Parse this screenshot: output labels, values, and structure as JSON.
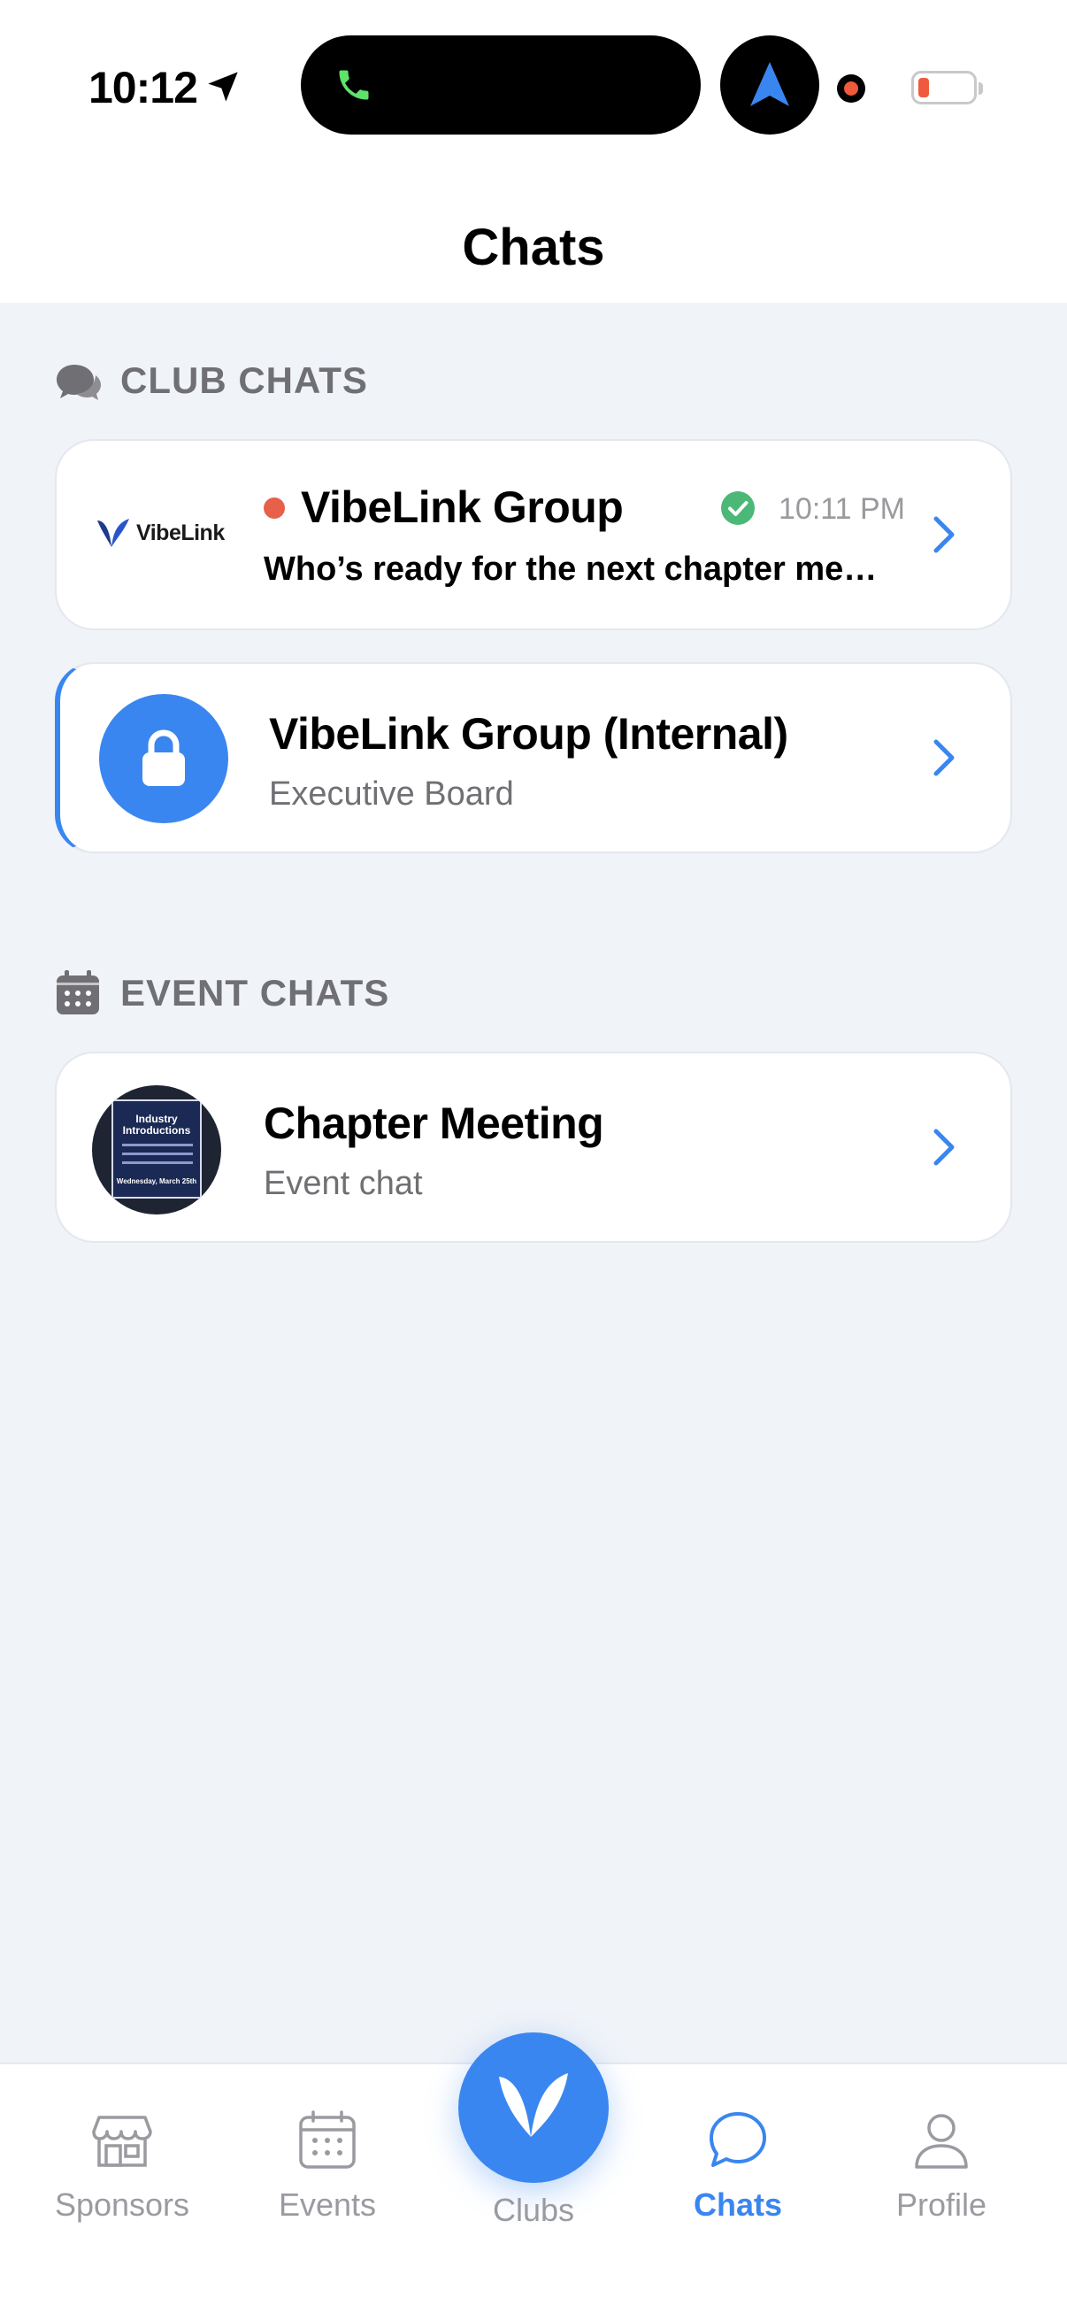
{
  "status_bar": {
    "time": "10:12"
  },
  "header": {
    "title": "Chats"
  },
  "club_chats": {
    "label": "CLUB CHATS",
    "items": [
      {
        "logo_text": "VibeLink",
        "title": "VibeLink Group",
        "time": "10:11 PM",
        "preview": "Who’s ready for the next chapter meet..."
      },
      {
        "title": "VibeLink Group (Internal)",
        "subtitle": "Executive Board"
      }
    ]
  },
  "event_chats": {
    "label": "EVENT CHATS",
    "items": [
      {
        "title": "Chapter Meeting",
        "subtitle": "Event chat",
        "thumb_title": "Industry Introductions",
        "thumb_date": "Wednesday, March 25th"
      }
    ]
  },
  "tabs": [
    {
      "label": "Sponsors",
      "icon": "storefront-icon"
    },
    {
      "label": "Events",
      "icon": "calendar-icon"
    },
    {
      "label": "Clubs",
      "icon": "butterfly-logo-icon"
    },
    {
      "label": "Chats",
      "icon": "chat-bubble-icon",
      "active": true
    },
    {
      "label": "Profile",
      "icon": "person-icon"
    }
  ],
  "colors": {
    "accent": "#3a86f0",
    "unread": "#e6604a",
    "success": "#4cb878",
    "muted": "#707074",
    "background": "#f0f3f8"
  }
}
